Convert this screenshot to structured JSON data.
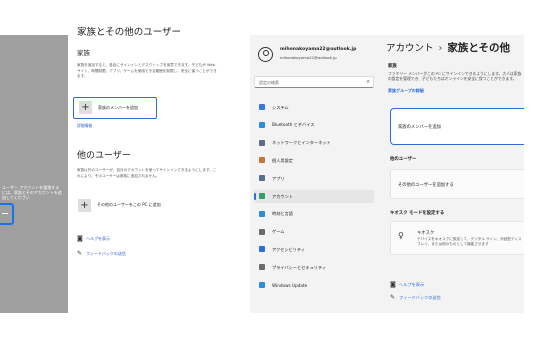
{
  "left": {
    "sidebar": {
      "text": "ユーザー アカウントを管理するには、家族とそのアカウントを追加してください"
    },
    "title": "家族とその他のユーザー",
    "family": {
      "heading": "家族",
      "description": "家族を追加すると、各自にサインインとデスクトップを用意できます。子どもが Web サイト、時間制限、アプリ、ゲームを使用できる範囲を制限し、安全に保つことができます。",
      "add_label": "家族のメンバーを追加",
      "link": "詳細情報"
    },
    "others": {
      "heading": "他のユーザー",
      "description": "家族以外のユーザーが、自分のアカウントを使ってサインインできるようにします。これにより、そのユーザーは家族に追加されません。",
      "add_label": "その他のユーザーをこの PC に追加"
    },
    "help": "ヘルプを表示",
    "feedback": "フィードバックの送信"
  },
  "right": {
    "account": {
      "email": "mihonakoyama22@outlook.jp",
      "email_sub": "mihonakoyama22@outlook.jp"
    },
    "search": {
      "placeholder": "設定の検索"
    },
    "nav": [
      {
        "label": "システム",
        "color": "#3a78d8"
      },
      {
        "label": "Bluetooth とデバイス",
        "color": "#2a8fd8"
      },
      {
        "label": "ネットワークとインターネット",
        "color": "#5a6d8a"
      },
      {
        "label": "個人用設定",
        "color": "#c07a3a"
      },
      {
        "label": "アプリ",
        "color": "#5a6d8a"
      },
      {
        "label": "アカウント",
        "color": "#2f9e6a"
      },
      {
        "label": "時刻と言語",
        "color": "#2a8fd8"
      },
      {
        "label": "ゲーム",
        "color": "#6a6a6a"
      },
      {
        "label": "アクセシビリティ",
        "color": "#2a6fd8"
      },
      {
        "label": "プライバシーとセキュリティ",
        "color": "#6a6a6a"
      },
      {
        "label": "Windows Update",
        "color": "#2a8fd8"
      }
    ],
    "breadcrumb": {
      "parent": "アカウント",
      "separator": "›",
      "current": "家族とその他"
    },
    "family": {
      "heading": "家族",
      "description": "ファミリー メンバーがこの PC にサインインできるようにします。大人は家族の設定を管理でき、子どもたちはオンラインを安全に保つことができます。",
      "link": "家族グループの詳細",
      "add_label": "家族のメンバーを追加"
    },
    "others": {
      "heading": "他のユーザー",
      "add_label": "その他のユーザーを追加する"
    },
    "kiosk": {
      "heading": "キオスク モードを設定する",
      "title": "キオスク",
      "description": "デバイスをキオスクに設定して、デジタル サイン、対話型ディスプレイ、または他のものとして機能させます"
    },
    "help": "ヘルプを表示",
    "feedback": "フィードバックの送信"
  },
  "colors": {
    "accent": "#2b6fd6",
    "sidebar_gray": "#9f9f9f",
    "right_bg": "#f3f3f3"
  }
}
